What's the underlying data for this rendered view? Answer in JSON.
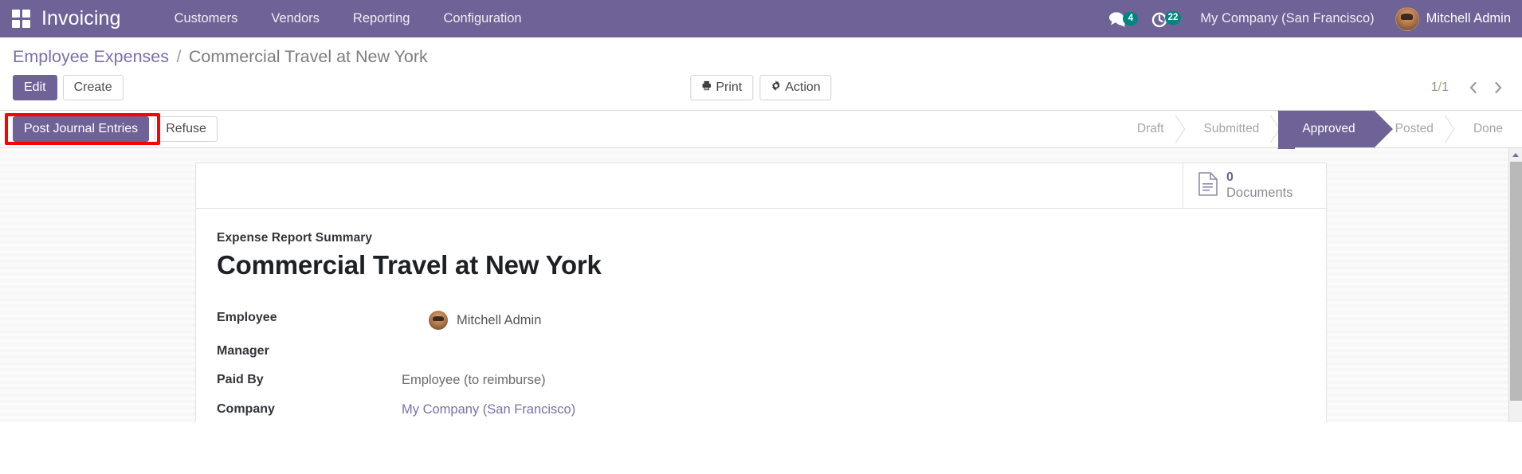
{
  "navbar": {
    "apps_icon": "apps-grid-icon",
    "brand": "Invoicing",
    "menus": [
      {
        "label": "Customers"
      },
      {
        "label": "Vendors"
      },
      {
        "label": "Reporting"
      },
      {
        "label": "Configuration"
      }
    ],
    "messages_icon": "chat-bubble-icon",
    "messages_count": "4",
    "activities_icon": "clock-activity-icon",
    "activities_count": "22",
    "company": "My Company (San Francisco)",
    "user": "Mitchell Admin",
    "avatar_icon": "user-avatar"
  },
  "breadcrumb": {
    "root": "Employee Expenses",
    "separator": "/",
    "current": "Commercial Travel at New York"
  },
  "toolbar": {
    "edit_label": "Edit",
    "create_label": "Create",
    "print_label": "Print",
    "print_icon": "printer-icon",
    "action_label": "Action",
    "action_icon": "gear-icon",
    "pager_value": "1",
    "pager_sep": "/",
    "pager_total": "1",
    "prev_icon": "chevron-left-icon",
    "next_icon": "chevron-right-icon"
  },
  "statusbar": {
    "post_journal_entries_label": "Post Journal Entries",
    "refuse_label": "Refuse",
    "highlight_color": "#ff0000",
    "active_color": "#6f6296",
    "stages": [
      {
        "label": "Draft",
        "active": false
      },
      {
        "label": "Submitted",
        "active": false
      },
      {
        "label": "Approved",
        "active": true
      },
      {
        "label": "Posted",
        "active": false
      },
      {
        "label": "Done",
        "active": false
      }
    ]
  },
  "sheet": {
    "smart_button": {
      "icon": "document-icon",
      "count": "0",
      "label": "Documents"
    },
    "summary_label": "Expense Report Summary",
    "title": "Commercial Travel at New York",
    "fields": [
      {
        "label": "Employee",
        "value": "Mitchell Admin",
        "style": "avatar"
      },
      {
        "label": "Manager",
        "value": "",
        "style": "plain"
      },
      {
        "label": "Paid By",
        "value": "Employee (to reimburse)",
        "style": "plain"
      },
      {
        "label": "Company",
        "value": "My Company (San Francisco)",
        "style": "link"
      }
    ]
  },
  "scrollbar": {
    "up_icon": "scroll-up-arrow-icon"
  }
}
